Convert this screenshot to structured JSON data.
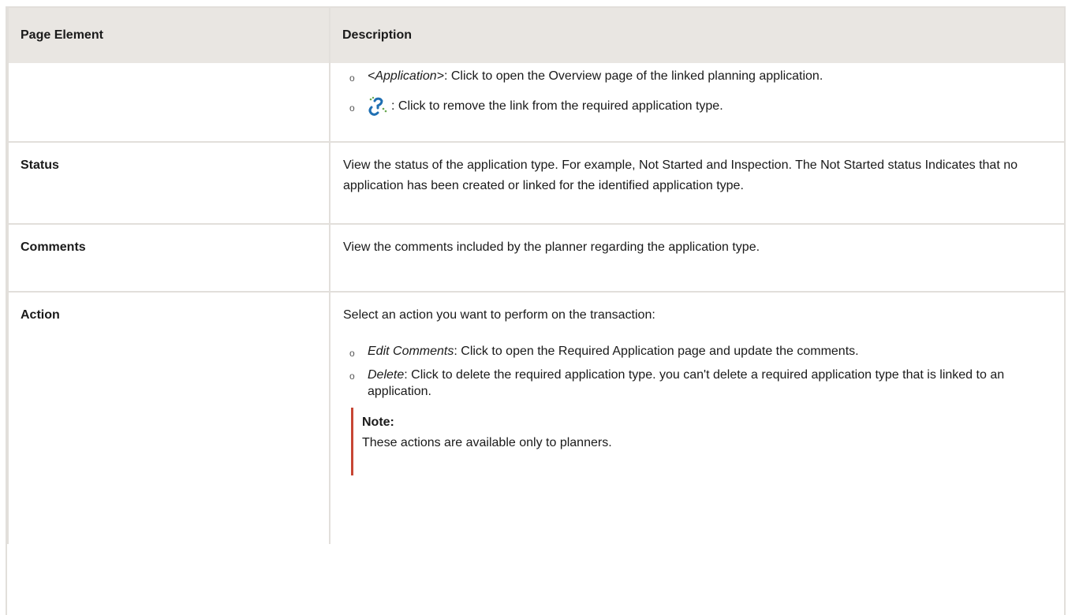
{
  "header": {
    "col1": "Page Element",
    "col2": "Description"
  },
  "row_links": {
    "application_term": "<Application>",
    "application_text": ": Click to open the Overview page of the linked planning application.",
    "unlink_text": ": Click to remove the link from the required application type."
  },
  "row_status": {
    "element": "Status",
    "description": "View the status of the application type. For example, Not Started and Inspection. The Not Started status Indicates that no application has been created or linked for the identified application type."
  },
  "row_comments": {
    "element": "Comments",
    "description": "View the comments included by the planner regarding the application type."
  },
  "row_action": {
    "element": "Action",
    "intro": "Select an action you want to perform on the transaction:",
    "items": [
      {
        "term": "Edit Comments",
        "text": ": Click to open the Required Application page and update the comments."
      },
      {
        "term": "Delete",
        "text": ": Click to delete the required application type. you can't delete a required application type that is linked to an application."
      }
    ],
    "note_title": "Note:",
    "note_text": "These actions are available only to planners."
  },
  "colors": {
    "header_bg": "#e9e6e2",
    "border": "#e2dfdb",
    "note_accent": "#c74634",
    "icon_blue": "#1f6fb2",
    "icon_green": "#6aa84f"
  },
  "icons": {
    "unlink": "unlink-icon",
    "bullet": "hollow-circle-bullet"
  }
}
